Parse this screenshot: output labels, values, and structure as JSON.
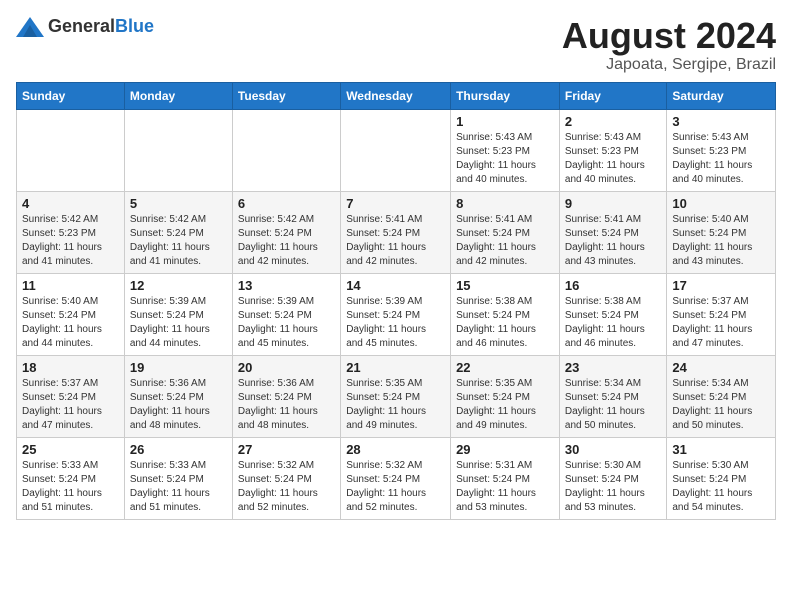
{
  "header": {
    "logo_general": "General",
    "logo_blue": "Blue",
    "title": "August 2024",
    "location": "Japoata, Sergipe, Brazil"
  },
  "weekdays": [
    "Sunday",
    "Monday",
    "Tuesday",
    "Wednesday",
    "Thursday",
    "Friday",
    "Saturday"
  ],
  "weeks": [
    [
      {
        "day": "",
        "info": ""
      },
      {
        "day": "",
        "info": ""
      },
      {
        "day": "",
        "info": ""
      },
      {
        "day": "",
        "info": ""
      },
      {
        "day": "1",
        "info": "Sunrise: 5:43 AM\nSunset: 5:23 PM\nDaylight: 11 hours\nand 40 minutes."
      },
      {
        "day": "2",
        "info": "Sunrise: 5:43 AM\nSunset: 5:23 PM\nDaylight: 11 hours\nand 40 minutes."
      },
      {
        "day": "3",
        "info": "Sunrise: 5:43 AM\nSunset: 5:23 PM\nDaylight: 11 hours\nand 40 minutes."
      }
    ],
    [
      {
        "day": "4",
        "info": "Sunrise: 5:42 AM\nSunset: 5:23 PM\nDaylight: 11 hours\nand 41 minutes."
      },
      {
        "day": "5",
        "info": "Sunrise: 5:42 AM\nSunset: 5:24 PM\nDaylight: 11 hours\nand 41 minutes."
      },
      {
        "day": "6",
        "info": "Sunrise: 5:42 AM\nSunset: 5:24 PM\nDaylight: 11 hours\nand 42 minutes."
      },
      {
        "day": "7",
        "info": "Sunrise: 5:41 AM\nSunset: 5:24 PM\nDaylight: 11 hours\nand 42 minutes."
      },
      {
        "day": "8",
        "info": "Sunrise: 5:41 AM\nSunset: 5:24 PM\nDaylight: 11 hours\nand 42 minutes."
      },
      {
        "day": "9",
        "info": "Sunrise: 5:41 AM\nSunset: 5:24 PM\nDaylight: 11 hours\nand 43 minutes."
      },
      {
        "day": "10",
        "info": "Sunrise: 5:40 AM\nSunset: 5:24 PM\nDaylight: 11 hours\nand 43 minutes."
      }
    ],
    [
      {
        "day": "11",
        "info": "Sunrise: 5:40 AM\nSunset: 5:24 PM\nDaylight: 11 hours\nand 44 minutes."
      },
      {
        "day": "12",
        "info": "Sunrise: 5:39 AM\nSunset: 5:24 PM\nDaylight: 11 hours\nand 44 minutes."
      },
      {
        "day": "13",
        "info": "Sunrise: 5:39 AM\nSunset: 5:24 PM\nDaylight: 11 hours\nand 45 minutes."
      },
      {
        "day": "14",
        "info": "Sunrise: 5:39 AM\nSunset: 5:24 PM\nDaylight: 11 hours\nand 45 minutes."
      },
      {
        "day": "15",
        "info": "Sunrise: 5:38 AM\nSunset: 5:24 PM\nDaylight: 11 hours\nand 46 minutes."
      },
      {
        "day": "16",
        "info": "Sunrise: 5:38 AM\nSunset: 5:24 PM\nDaylight: 11 hours\nand 46 minutes."
      },
      {
        "day": "17",
        "info": "Sunrise: 5:37 AM\nSunset: 5:24 PM\nDaylight: 11 hours\nand 47 minutes."
      }
    ],
    [
      {
        "day": "18",
        "info": "Sunrise: 5:37 AM\nSunset: 5:24 PM\nDaylight: 11 hours\nand 47 minutes."
      },
      {
        "day": "19",
        "info": "Sunrise: 5:36 AM\nSunset: 5:24 PM\nDaylight: 11 hours\nand 48 minutes."
      },
      {
        "day": "20",
        "info": "Sunrise: 5:36 AM\nSunset: 5:24 PM\nDaylight: 11 hours\nand 48 minutes."
      },
      {
        "day": "21",
        "info": "Sunrise: 5:35 AM\nSunset: 5:24 PM\nDaylight: 11 hours\nand 49 minutes."
      },
      {
        "day": "22",
        "info": "Sunrise: 5:35 AM\nSunset: 5:24 PM\nDaylight: 11 hours\nand 49 minutes."
      },
      {
        "day": "23",
        "info": "Sunrise: 5:34 AM\nSunset: 5:24 PM\nDaylight: 11 hours\nand 50 minutes."
      },
      {
        "day": "24",
        "info": "Sunrise: 5:34 AM\nSunset: 5:24 PM\nDaylight: 11 hours\nand 50 minutes."
      }
    ],
    [
      {
        "day": "25",
        "info": "Sunrise: 5:33 AM\nSunset: 5:24 PM\nDaylight: 11 hours\nand 51 minutes."
      },
      {
        "day": "26",
        "info": "Sunrise: 5:33 AM\nSunset: 5:24 PM\nDaylight: 11 hours\nand 51 minutes."
      },
      {
        "day": "27",
        "info": "Sunrise: 5:32 AM\nSunset: 5:24 PM\nDaylight: 11 hours\nand 52 minutes."
      },
      {
        "day": "28",
        "info": "Sunrise: 5:32 AM\nSunset: 5:24 PM\nDaylight: 11 hours\nand 52 minutes."
      },
      {
        "day": "29",
        "info": "Sunrise: 5:31 AM\nSunset: 5:24 PM\nDaylight: 11 hours\nand 53 minutes."
      },
      {
        "day": "30",
        "info": "Sunrise: 5:30 AM\nSunset: 5:24 PM\nDaylight: 11 hours\nand 53 minutes."
      },
      {
        "day": "31",
        "info": "Sunrise: 5:30 AM\nSunset: 5:24 PM\nDaylight: 11 hours\nand 54 minutes."
      }
    ]
  ]
}
